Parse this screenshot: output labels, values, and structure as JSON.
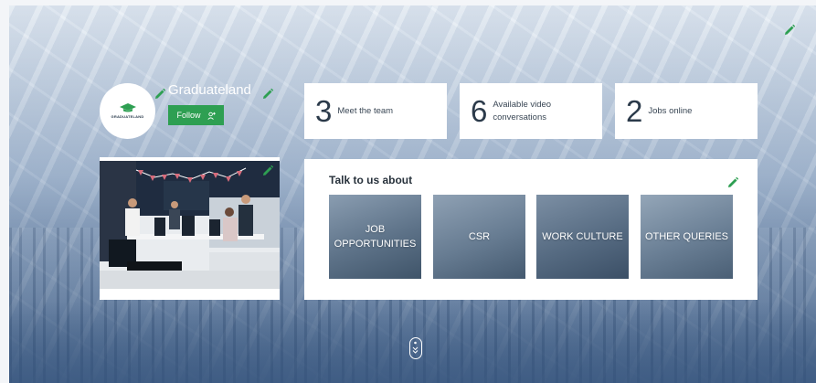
{
  "company": {
    "name": "Graduateland",
    "logo_text": "GRADUATELAND",
    "follow_label": "Follow"
  },
  "stats": [
    {
      "number": "3",
      "label": "Meet the team"
    },
    {
      "number": "6",
      "label": "Available video conversations"
    },
    {
      "number": "2",
      "label": "Jobs online"
    }
  ],
  "talk": {
    "title": "Talk to us about",
    "topics": [
      {
        "label": "JOB OPPORTUNITIES"
      },
      {
        "label": "CSR"
      },
      {
        "label": "WORK CULTURE"
      },
      {
        "label": "OTHER QUERIES"
      }
    ]
  },
  "colors": {
    "brand_green": "#2e9f52",
    "text_dark": "#2b3a4a"
  },
  "icons": {
    "edit": "pencil-icon",
    "follow": "add-user-icon",
    "scroll": "scroll-down-icon"
  }
}
